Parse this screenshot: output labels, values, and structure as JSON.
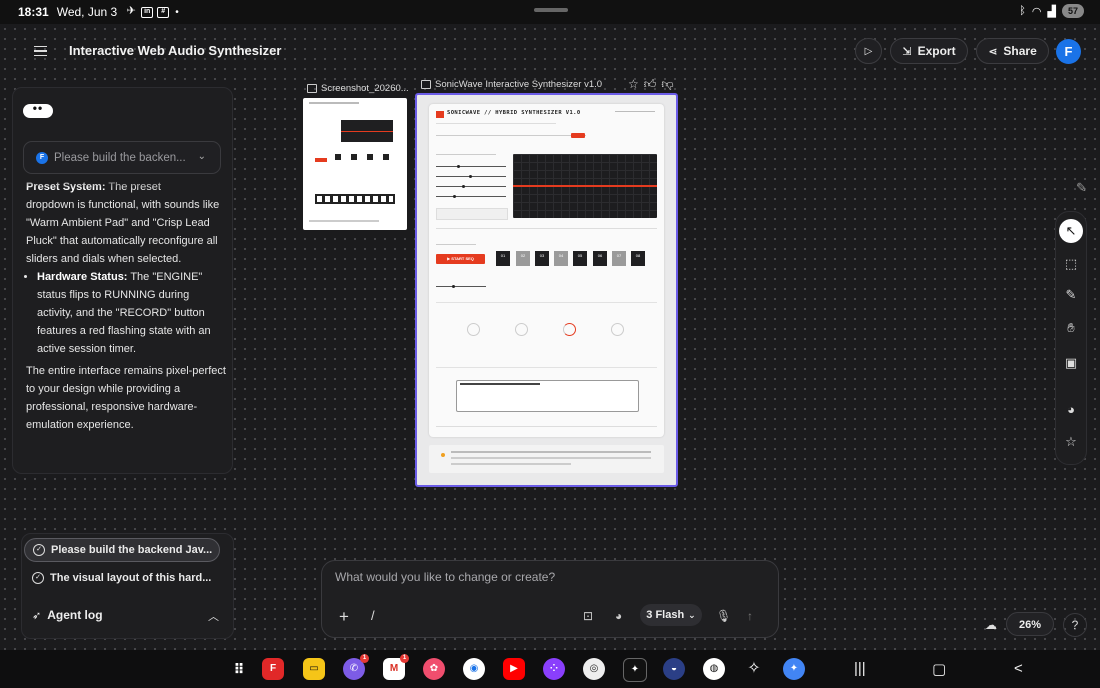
{
  "status_bar": {
    "time": "18:31",
    "date": "Wed, Jun 3",
    "battery": "57"
  },
  "header": {
    "title": "Interactive Web Audio Synthesizer",
    "export_label": "Export",
    "share_label": "Share",
    "avatar_initial": "F"
  },
  "chat": {
    "prompt_preview": "Please build the backen...",
    "user_initial": "F",
    "partial_heading": "Preset System:",
    "partial_text": " The preset",
    "bullet1_text": "dropdown is functional, with sounds like \"Warm Ambient Pad\" and \"Crisp Lead Pluck\" that automatically reconfigure all sliders and dials when selected.",
    "bullet2_heading": "Hardware Status:",
    "bullet2_text": " The \"ENGINE\" status flips to RUNNING during activity, and the \"RECORD\" button features a red flashing state with an active session timer.",
    "closing_text": "The entire interface remains pixel-perfect to your design while providing a professional, responsive hardware-emulation experience."
  },
  "tasks": {
    "items": [
      {
        "label": "Please build the backend Jav..."
      },
      {
        "label": "The visual layout of this hard..."
      }
    ],
    "agent_log_label": "Agent log"
  },
  "canvas": {
    "screenshot_label": "Screenshot_20260...",
    "main_frame_label": "SonicWave Interactive Synthesizer v1.0",
    "synth_title": "SONICWAVE // HYBRID SYNTHESIZER V1.0",
    "start_seq_label": "▶ START SEQ",
    "steps": [
      "01",
      "02",
      "03",
      "04",
      "05",
      "06",
      "07",
      "08"
    ]
  },
  "prompt": {
    "placeholder": "What would you like to change or create?",
    "model_label": "3 Flash"
  },
  "zoom": {
    "level": "26%"
  },
  "icons": {
    "menu": "hamburger-icon",
    "play": "play-icon",
    "export": "export-icon",
    "share": "share-icon",
    "star": "star-icon",
    "thumbs_up": "thumbs-up-icon",
    "thumbs_down": "thumbs-down-icon",
    "cursor": "cursor-icon",
    "select": "select-box-icon",
    "pencil": "pencil-icon",
    "hand": "hand-icon",
    "image": "image-icon",
    "palette": "palette-icon",
    "sparkle": "star-outline-icon"
  },
  "colors": {
    "accent": "#6b5ce7",
    "brand_blue": "#1a73e8",
    "synth_red": "#e53b1f"
  },
  "taskbar": {
    "apps": [
      "flipboard",
      "notes",
      "viber",
      "gmail",
      "photos",
      "chrome",
      "youtube",
      "galaxy-store",
      "camera",
      "gallery-edit",
      "game-launcher",
      "podcast",
      "gemini",
      "assistant"
    ],
    "viber_badge": "1",
    "gmail_badge": "1"
  }
}
